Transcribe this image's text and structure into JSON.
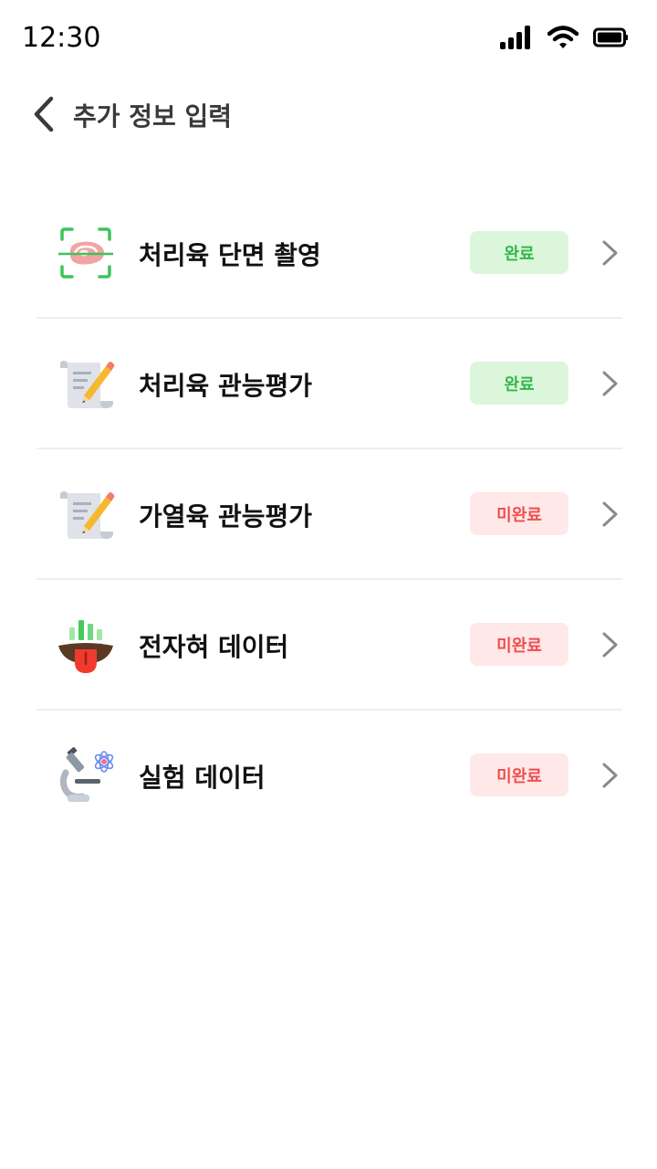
{
  "status_bar": {
    "time": "12:30",
    "icons": [
      "signal-icon",
      "wifi-icon",
      "battery-icon"
    ]
  },
  "header": {
    "back_icon": "chevron-left-icon",
    "title": "추가 정보 입력"
  },
  "colors": {
    "done_bg": "#dcf6dc",
    "done_text": "#32b84a",
    "todo_bg": "#ffe8e8",
    "todo_text": "#ef4d4d",
    "divider": "#eeeeee"
  },
  "items": [
    {
      "icon": "meat-scan-icon",
      "label": "처리육 단면 촬영",
      "status": "완료",
      "status_type": "done"
    },
    {
      "icon": "evaluation-form-icon",
      "label": "처리육 관능평가",
      "status": "완료",
      "status_type": "done"
    },
    {
      "icon": "evaluation-form-icon",
      "label": "가열육 관능평가",
      "status": "미완료",
      "status_type": "todo"
    },
    {
      "icon": "electronic-tongue-icon",
      "label": "전자혀 데이터",
      "status": "미완료",
      "status_type": "todo"
    },
    {
      "icon": "microscope-icon",
      "label": "실험 데이터",
      "status": "미완료",
      "status_type": "todo"
    }
  ]
}
